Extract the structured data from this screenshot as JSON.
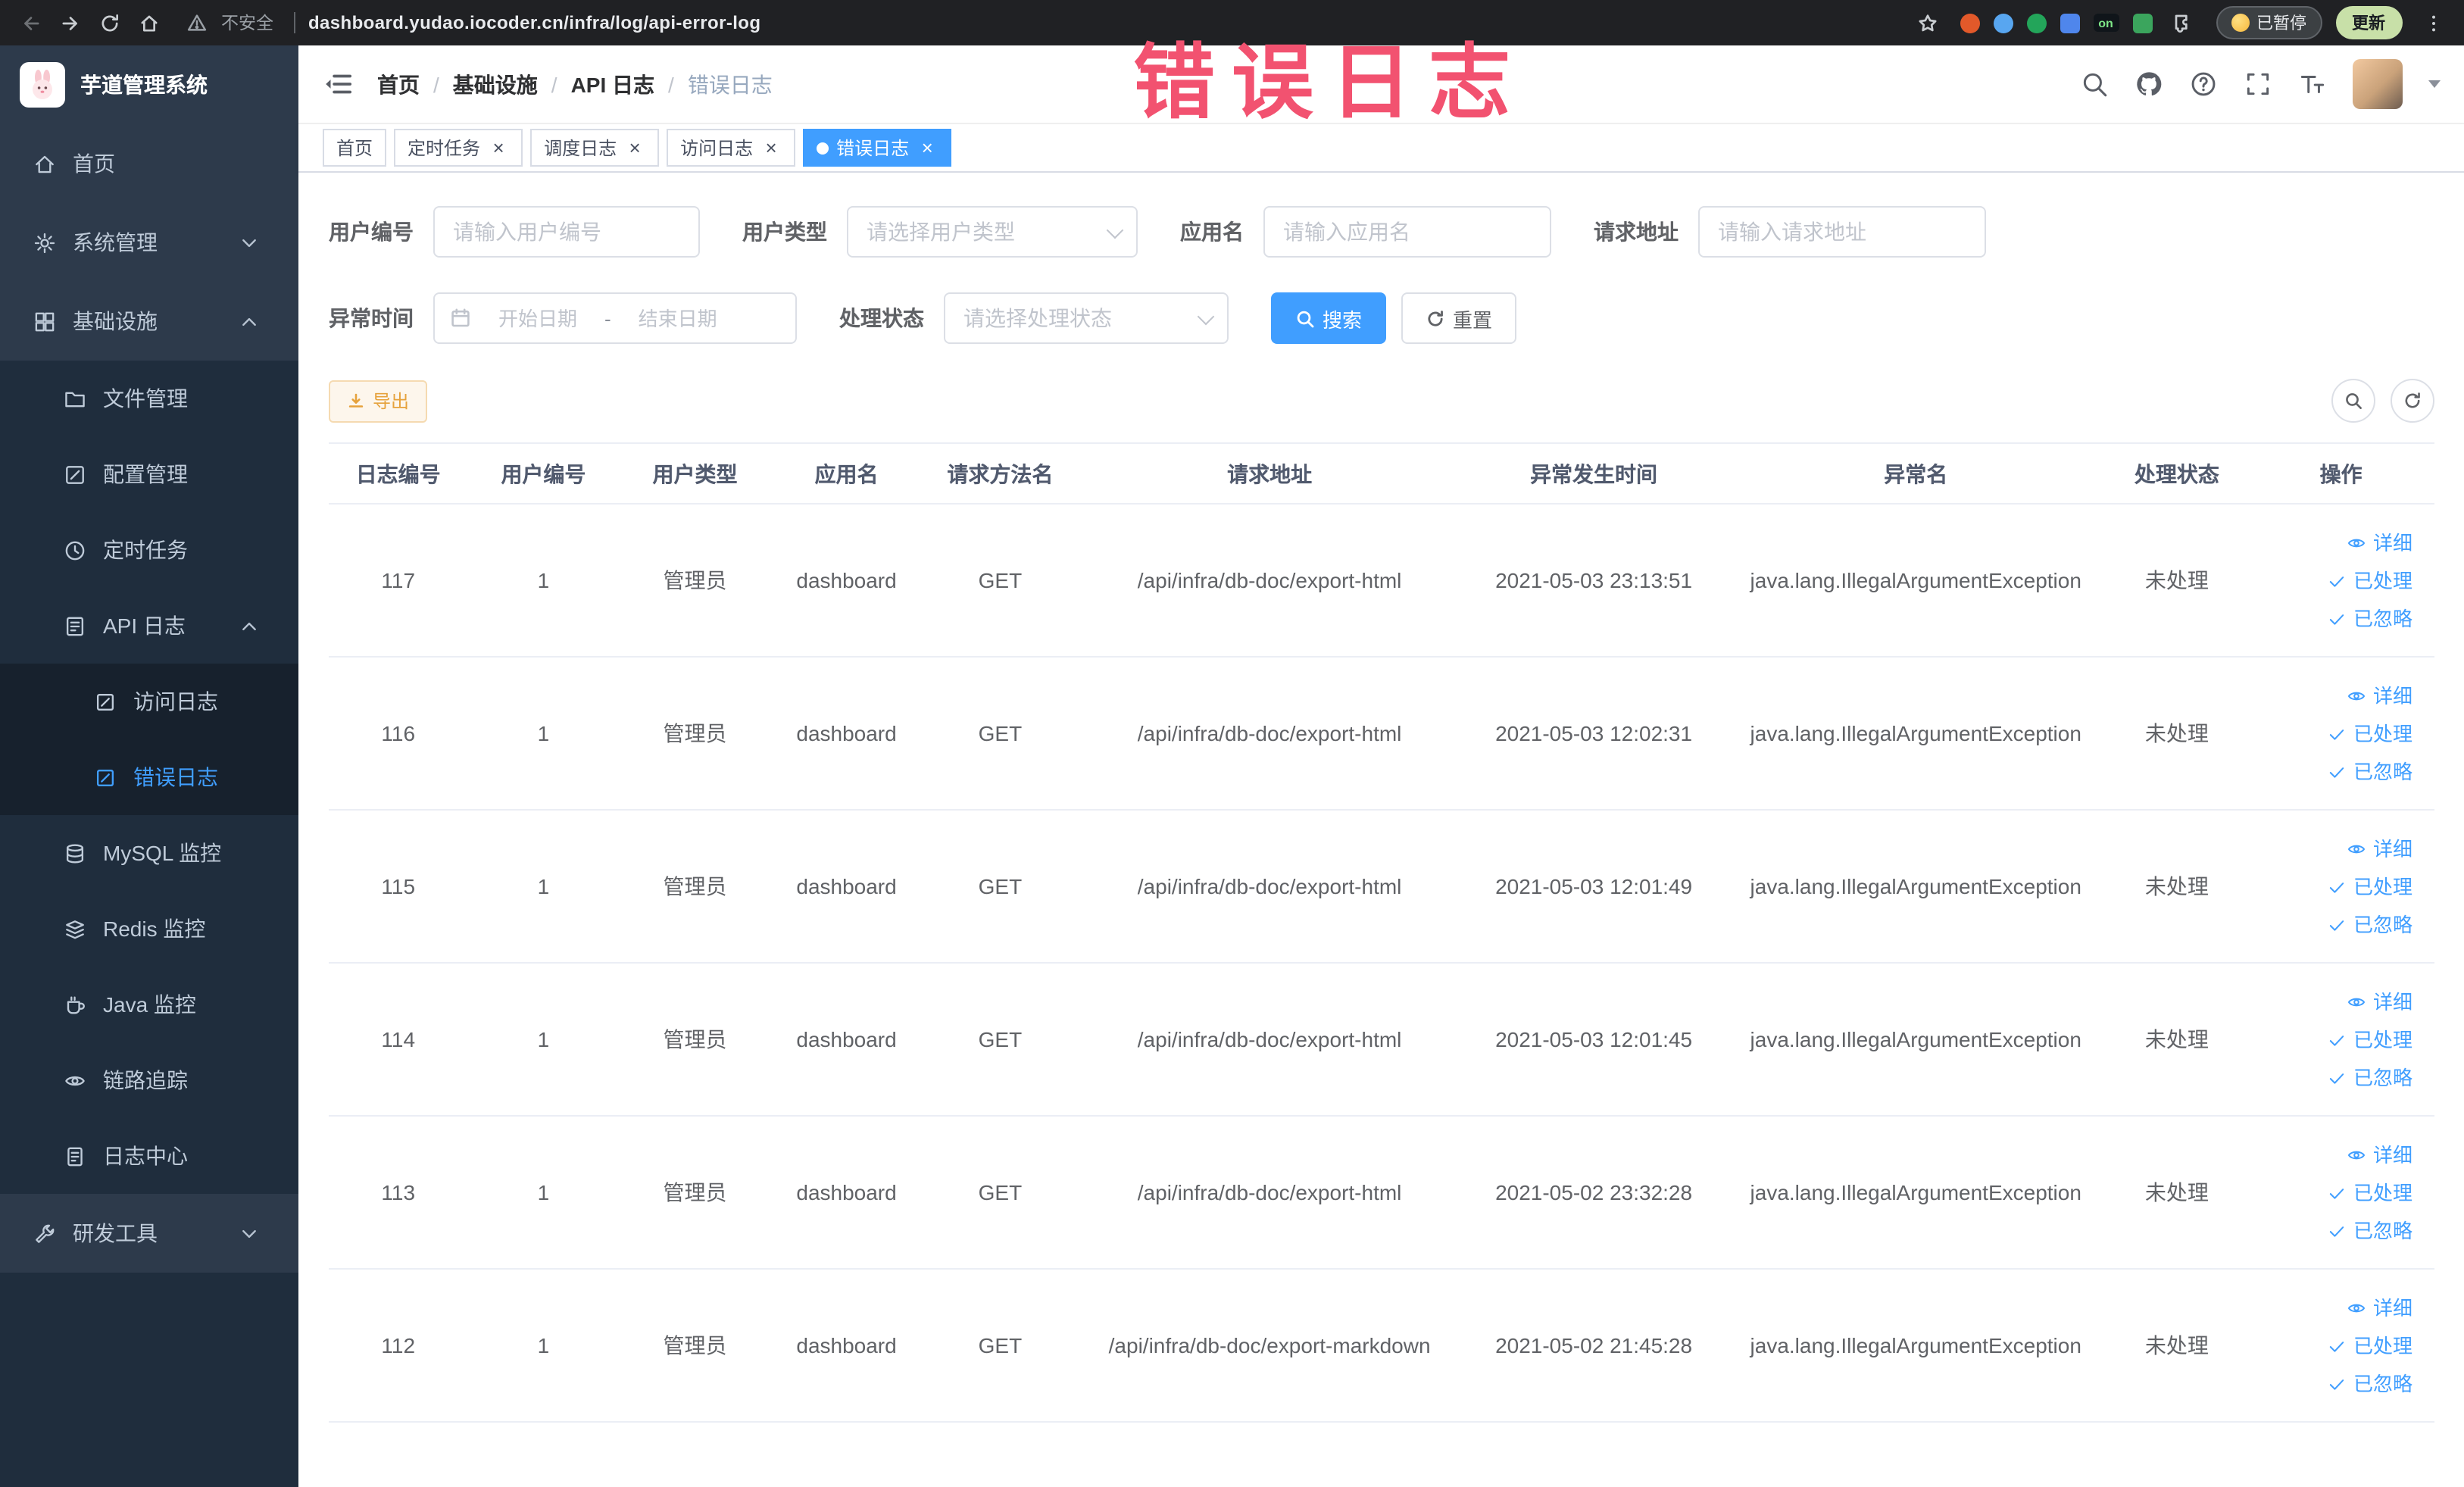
{
  "theme": {
    "primary": "#409eff",
    "link": "#409eff",
    "sidebar_bg": "#2d3a4b",
    "submenu_bg": "#1f2d3d",
    "nested_bg": "#17212d",
    "sidebar_text": "#bfcbd9",
    "browser_bg": "#202124",
    "warning": "#e6a23c",
    "table_border": "#ebeef5",
    "border": "#dcdfe6",
    "watermark_color": "#f25270"
  },
  "watermark": "错误日志",
  "browser": {
    "security_label": "不安全",
    "url": "dashboard.yudao.iocoder.cn/infra/log/api-error-log",
    "extensions_on_badge": "on",
    "paused_badge": "已暂停",
    "update_button": "更新"
  },
  "sidebar": {
    "logo_title": "芋道管理系统",
    "items": [
      {
        "key": "home",
        "label": "首页",
        "icon": "home-icon",
        "depth": 0
      },
      {
        "key": "system-management",
        "label": "系统管理",
        "icon": "gear-icon",
        "depth": 0,
        "chevron": "down"
      },
      {
        "key": "infrastructure",
        "label": "基础设施",
        "icon": "infra-icon",
        "depth": 0,
        "chevron": "up",
        "expanded": true
      },
      {
        "key": "file-management",
        "label": "文件管理",
        "icon": "folder-icon",
        "depth": 1
      },
      {
        "key": "config-management",
        "label": "配置管理",
        "icon": "config-icon",
        "depth": 1
      },
      {
        "key": "scheduled-tasks",
        "label": "定时任务",
        "icon": "clock-icon",
        "depth": 1
      },
      {
        "key": "api-log",
        "label": "API 日志",
        "icon": "api-log-icon",
        "depth": 1,
        "chevron": "up",
        "expanded": true
      },
      {
        "key": "access-log",
        "label": "访问日志",
        "icon": "doc-icon",
        "depth": 2
      },
      {
        "key": "error-log",
        "label": "错误日志",
        "icon": "doc-icon",
        "depth": 2,
        "active": true
      },
      {
        "key": "mysql-monitor",
        "label": "MySQL 监控",
        "icon": "mysql-icon",
        "depth": 1
      },
      {
        "key": "redis-monitor",
        "label": "Redis 监控",
        "icon": "redis-icon",
        "depth": 1
      },
      {
        "key": "java-monitor",
        "label": "Java 监控",
        "icon": "java-icon",
        "depth": 1
      },
      {
        "key": "link-tracing",
        "label": "链路追踪",
        "icon": "trace-icon",
        "depth": 1
      },
      {
        "key": "log-center",
        "label": "日志中心",
        "icon": "log-center-icon",
        "depth": 1
      },
      {
        "key": "dev-tools",
        "label": "研发工具",
        "icon": "tool-icon",
        "depth": 0,
        "chevron": "down"
      }
    ]
  },
  "header": {
    "breadcrumb": [
      "首页",
      "基础设施",
      "API 日志",
      "错误日志"
    ],
    "breadcrumb_separator": "/"
  },
  "tabs": [
    {
      "key": "home",
      "label": "首页",
      "closable": false,
      "active": false
    },
    {
      "key": "timed-task",
      "label": "定时任务",
      "closable": true,
      "active": false
    },
    {
      "key": "schedule-log",
      "label": "调度日志",
      "closable": true,
      "active": false
    },
    {
      "key": "access-log",
      "label": "访问日志",
      "closable": true,
      "active": false
    },
    {
      "key": "error-log",
      "label": "错误日志",
      "closable": true,
      "active": true
    }
  ],
  "filters": {
    "user_id": {
      "label": "用户编号",
      "placeholder": "请输入用户编号"
    },
    "user_type": {
      "label": "用户类型",
      "placeholder": "请选择用户类型"
    },
    "app_name": {
      "label": "应用名",
      "placeholder": "请输入应用名"
    },
    "request_url": {
      "label": "请求地址",
      "placeholder": "请输入请求地址"
    },
    "exception_time": {
      "label": "异常时间",
      "start_placeholder": "开始日期",
      "separator": "-",
      "end_placeholder": "结束日期"
    },
    "process_status": {
      "label": "处理状态",
      "placeholder": "请选择处理状态"
    },
    "search_label": "搜索",
    "reset_label": "重置"
  },
  "toolbar": {
    "export_label": "导出"
  },
  "row_actions": [
    {
      "key": "detail",
      "label": "详细",
      "icon": "eye-icon"
    },
    {
      "key": "processed",
      "label": "已处理",
      "icon": "check-icon"
    },
    {
      "key": "ignored",
      "label": "已忽略",
      "icon": "check-icon"
    }
  ],
  "table": {
    "columns": [
      "日志编号",
      "用户编号",
      "用户类型",
      "应用名",
      "请求方法名",
      "请求地址",
      "异常发生时间",
      "异常名",
      "处理状态",
      "操作"
    ],
    "rows": [
      {
        "id": "117",
        "user_id": "1",
        "user_type": "管理员",
        "app": "dashboard",
        "method": "GET",
        "url": "/api/infra/db-doc/export-html",
        "time": "2021-05-03 23:13:51",
        "exception": "java.lang.IllegalArgumentException",
        "status": "未处理"
      },
      {
        "id": "116",
        "user_id": "1",
        "user_type": "管理员",
        "app": "dashboard",
        "method": "GET",
        "url": "/api/infra/db-doc/export-html",
        "time": "2021-05-03 12:02:31",
        "exception": "java.lang.IllegalArgumentException",
        "status": "未处理"
      },
      {
        "id": "115",
        "user_id": "1",
        "user_type": "管理员",
        "app": "dashboard",
        "method": "GET",
        "url": "/api/infra/db-doc/export-html",
        "time": "2021-05-03 12:01:49",
        "exception": "java.lang.IllegalArgumentException",
        "status": "未处理"
      },
      {
        "id": "114",
        "user_id": "1",
        "user_type": "管理员",
        "app": "dashboard",
        "method": "GET",
        "url": "/api/infra/db-doc/export-html",
        "time": "2021-05-03 12:01:45",
        "exception": "java.lang.IllegalArgumentException",
        "status": "未处理"
      },
      {
        "id": "113",
        "user_id": "1",
        "user_type": "管理员",
        "app": "dashboard",
        "method": "GET",
        "url": "/api/infra/db-doc/export-html",
        "time": "2021-05-02 23:32:28",
        "exception": "java.lang.IllegalArgumentException",
        "status": "未处理"
      },
      {
        "id": "112",
        "user_id": "1",
        "user_type": "管理员",
        "app": "dashboard",
        "method": "GET",
        "url": "/api/infra/db-doc/export-markdown",
        "time": "2021-05-02 21:45:28",
        "exception": "java.lang.IllegalArgumentException",
        "status": "未处理"
      }
    ]
  }
}
